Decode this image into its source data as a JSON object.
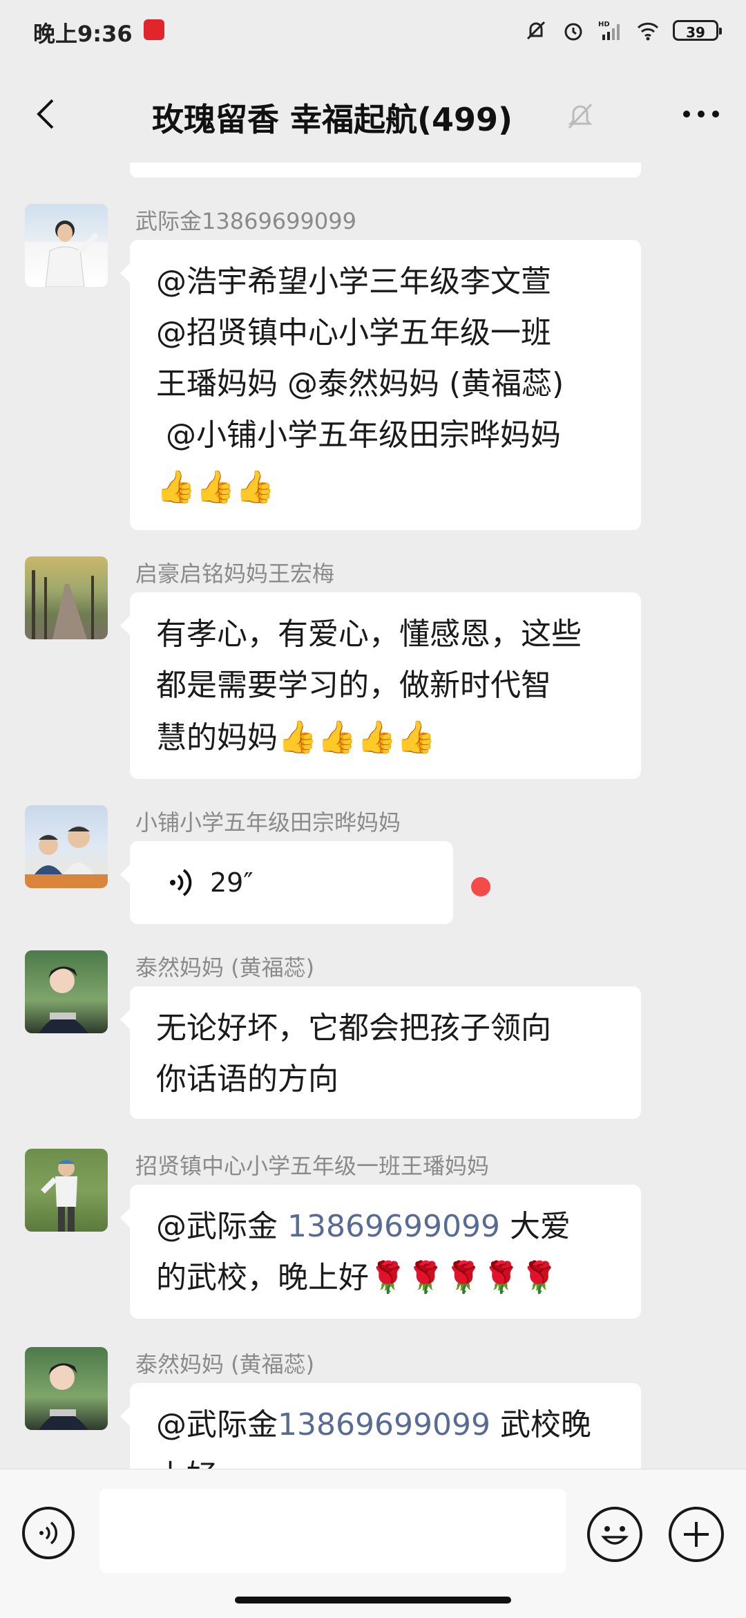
{
  "status_bar": {
    "time": "晚上9:36",
    "battery": "39",
    "icons": [
      "app-notification-icon",
      "mute-notification-icon",
      "alarm-icon",
      "hd-signal-icon",
      "wifi-icon",
      "battery-icon"
    ]
  },
  "header": {
    "title": "玫瑰留香  幸福起航(499)",
    "icons": [
      "back-arrow-icon",
      "mute-bell-icon",
      "more-dots-icon"
    ]
  },
  "messages": [
    {
      "sender": "武际金13869699099",
      "lines": [
        "@浩宇希望小学三年级李文萱",
        "@招贤镇中心小学五年级一班",
        "王璠妈妈 @泰然妈妈 (黄福蕊)",
        " @小铺小学五年级田宗晔妈妈"
      ],
      "emoji": "👍👍👍"
    },
    {
      "sender": "启豪启铭妈妈王宏梅",
      "lines": [
        "有孝心，有爱心，懂感恩，这些",
        "都是需要学习的，做新时代智"
      ],
      "last_line": "慧的妈妈",
      "emoji": "👍👍👍👍"
    },
    {
      "sender": "小铺小学五年级田宗晔妈妈",
      "voice_duration": "29″"
    },
    {
      "sender": "泰然妈妈 (黄福蕊)",
      "lines": [
        "无论好坏，它都会把孩子领向",
        "你话语的方向"
      ]
    },
    {
      "sender": "招贤镇中心小学五年级一班王璠妈妈",
      "mention": "@武际金",
      "mention_number": "13869699099",
      "after_mention": "大爱",
      "line2": "的武校，晚上好",
      "emoji": "🌹🌹🌹🌹🌹"
    },
    {
      "sender": "泰然妈妈 (黄福蕊)",
      "mention": "@武际金",
      "mention_number": "13869699099",
      "after_mention": "武校晚",
      "line2": "上好"
    }
  ],
  "input_bar": {
    "placeholder": "",
    "icons": [
      "voice-toggle-icon",
      "emoji-icon",
      "plus-icon"
    ]
  }
}
